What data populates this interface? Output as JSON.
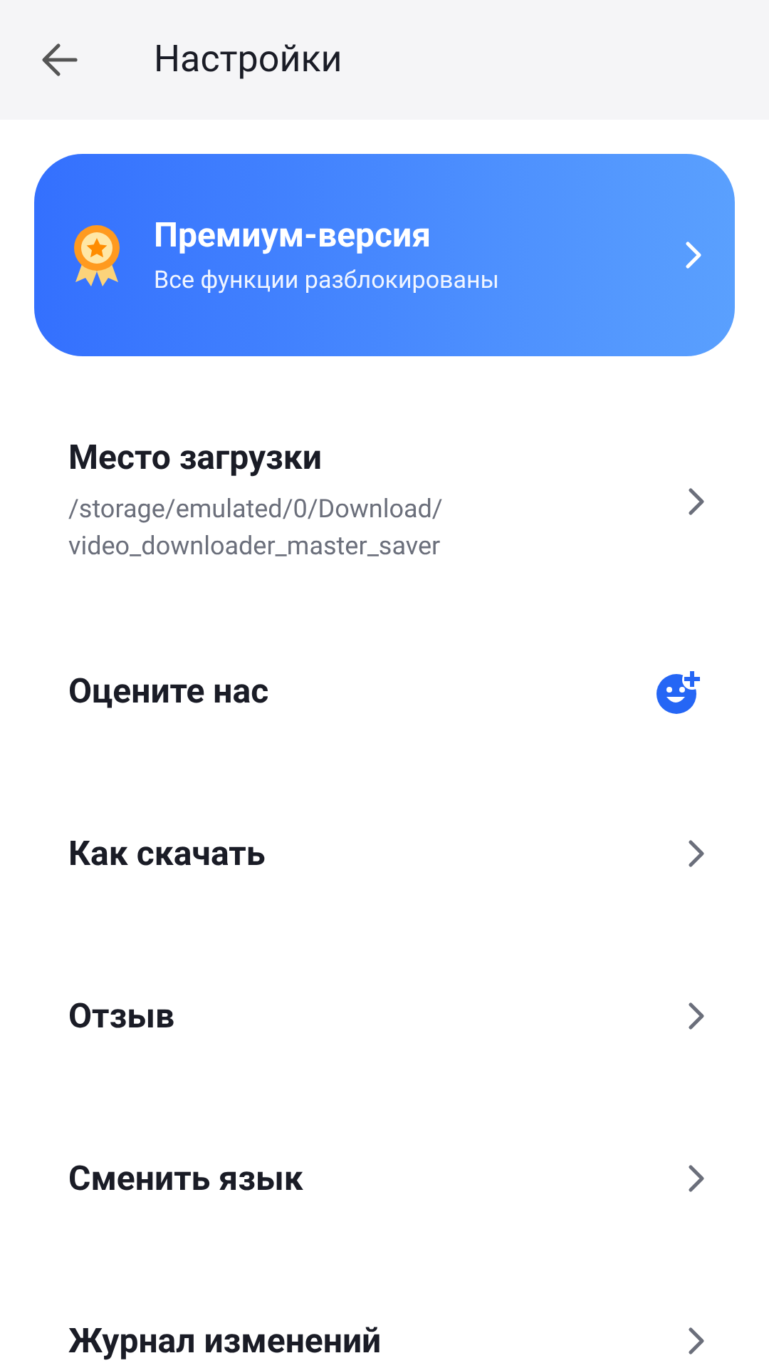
{
  "header": {
    "title": "Настройки"
  },
  "premium": {
    "title": "Премиум-версия",
    "subtitle": "Все функции разблокированы"
  },
  "items": [
    {
      "kind": "chevron",
      "title": "Место загрузки",
      "subtitle": "/storage/emulated/0/Download/\nvideo_downloader_master_saver"
    },
    {
      "kind": "rate",
      "title": "Оцените нас"
    },
    {
      "kind": "chevron",
      "title": "Как скачать"
    },
    {
      "kind": "chevron",
      "title": "Отзыв"
    },
    {
      "kind": "chevron",
      "title": "Сменить язык"
    },
    {
      "kind": "chevron",
      "title": "Журнал изменений"
    }
  ]
}
